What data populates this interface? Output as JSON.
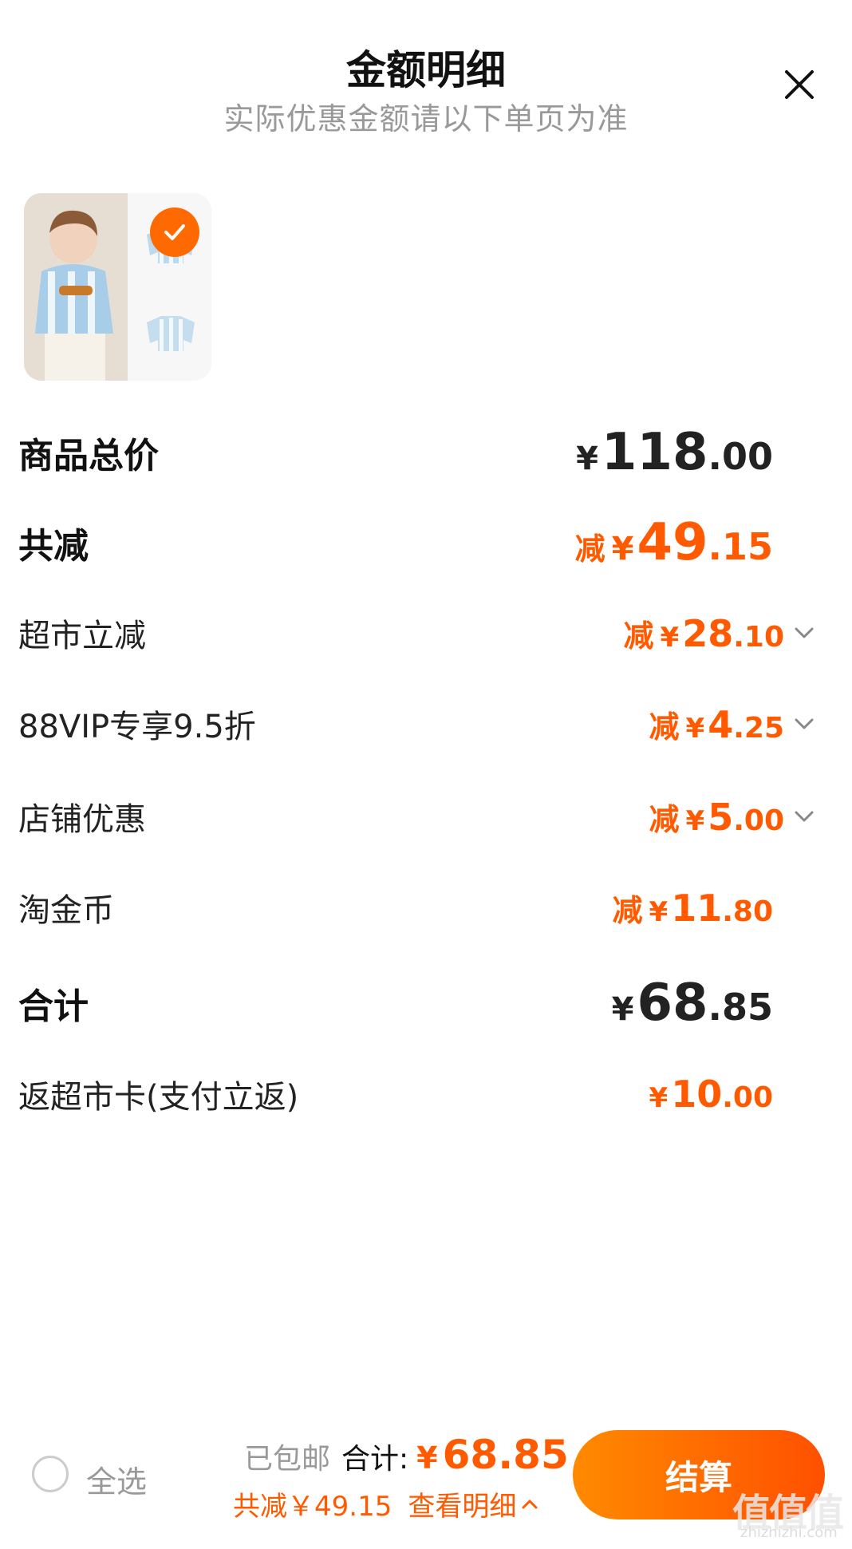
{
  "header": {
    "title": "金额明细",
    "subtitle": "实际优惠金额请以下单页为准"
  },
  "colors": {
    "accent": "#ff5a00",
    "checkout_start": "#ff8a00",
    "checkout_end": "#ff5000"
  },
  "icons": {
    "close": "close-icon",
    "check": "check-icon",
    "chevron": "chevron-down-icon",
    "up": "chevron-up-icon"
  },
  "rows": [
    {
      "label": "商品总价",
      "prefix": "",
      "yen": "¥",
      "int": "118",
      "dec": ".00"
    },
    {
      "label": "共减",
      "prefix": "减",
      "yen": "¥",
      "int": "49",
      "dec": ".15"
    },
    {
      "label": "超市立减",
      "prefix": "减",
      "yen": "¥",
      "int": "28",
      "dec": ".10"
    },
    {
      "label": "88VIP专享9.5折",
      "prefix": "减",
      "yen": "¥",
      "int": "4",
      "dec": ".25"
    },
    {
      "label": "店铺优惠",
      "prefix": "减",
      "yen": "¥",
      "int": "5",
      "dec": ".00"
    },
    {
      "label": "淘金币",
      "prefix": "减",
      "yen": "¥",
      "int": "11",
      "dec": ".80"
    },
    {
      "label": "合计",
      "prefix": "",
      "yen": "¥",
      "int": "68",
      "dec": ".85"
    },
    {
      "label": "返超市卡(支付立返)",
      "prefix": "",
      "yen": "¥",
      "int": "10",
      "dec": ".00"
    }
  ],
  "footer": {
    "select_all": "全选",
    "shipping": "已包邮",
    "total_label": "合计:",
    "total_yen": "¥",
    "total_value": "68.85",
    "saved": "共减￥49.15",
    "view_detail": "查看明细",
    "checkout": "结算"
  },
  "watermark": {
    "text": "值值值",
    "sub": "zhizhizhi.com"
  }
}
